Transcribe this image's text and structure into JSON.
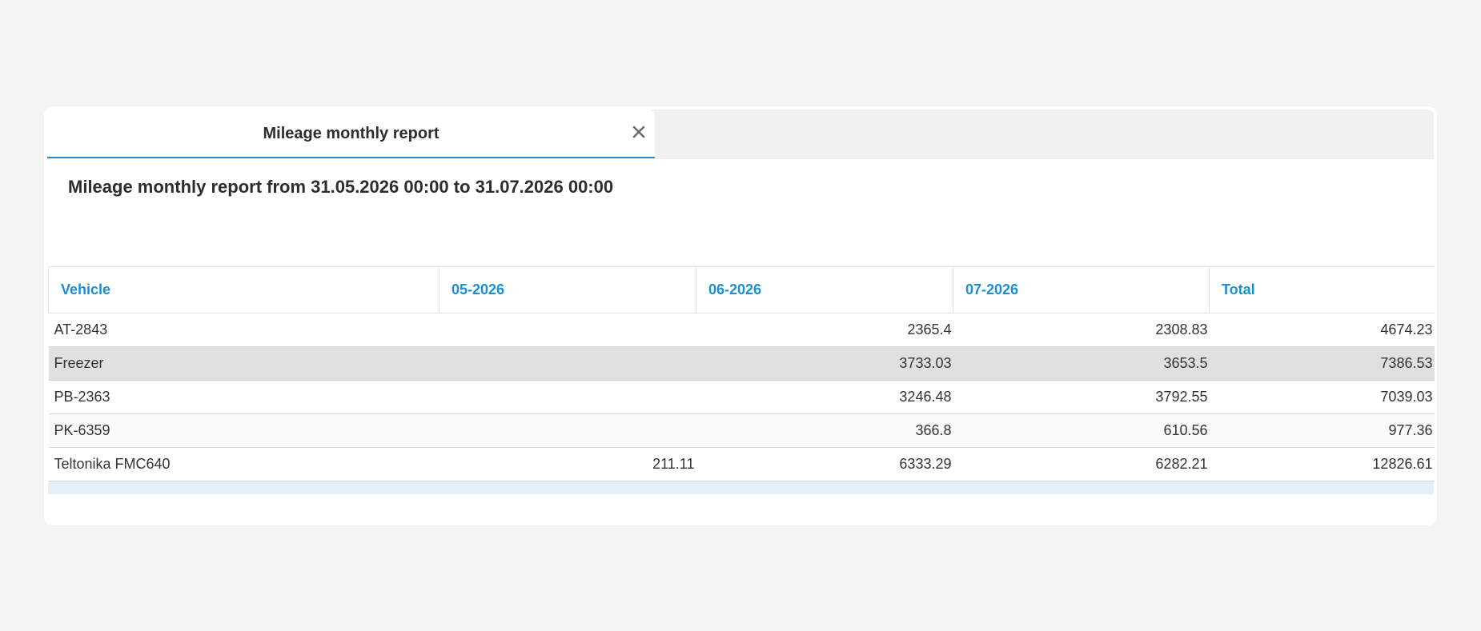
{
  "tab": {
    "label": "Mileage monthly report",
    "close_icon": "close-icon"
  },
  "report": {
    "title": "Mileage monthly report from 31.05.2026 00:00 to 31.07.2026 00:00"
  },
  "table": {
    "headers": [
      "Vehicle",
      "05-2026",
      "06-2026",
      "07-2026",
      "Total"
    ],
    "rows": [
      {
        "vehicle": "AT-2843",
        "m05": "",
        "m06": "2365.4",
        "m07": "2308.83",
        "total": "4674.23"
      },
      {
        "vehicle": "Freezer",
        "m05": "",
        "m06": "3733.03",
        "m07": "3653.5",
        "total": "7386.53"
      },
      {
        "vehicle": "PB-2363",
        "m05": "",
        "m06": "3246.48",
        "m07": "3792.55",
        "total": "7039.03"
      },
      {
        "vehicle": "PK-6359",
        "m05": "",
        "m06": "366.8",
        "m07": "610.56",
        "total": "977.36"
      },
      {
        "vehicle": "Teltonika FMC640",
        "m05": "211.11",
        "m06": "6333.29",
        "m07": "6282.21",
        "total": "12826.61"
      }
    ]
  },
  "colors": {
    "accent": "#1b8fd0",
    "selected_row": "#e0e0e0",
    "footer_strip": "#e3f0f9"
  }
}
